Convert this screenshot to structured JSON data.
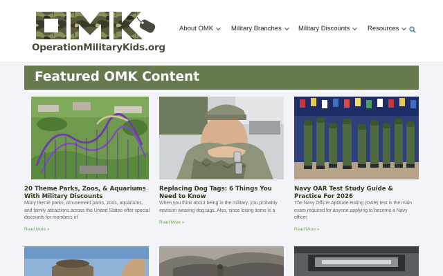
{
  "header": {
    "logo_text": "OperationMilitaryKids.org",
    "nav": [
      {
        "label": "About OMK",
        "icon": "chevron-down-icon"
      },
      {
        "label": "Military Branches",
        "icon": "chevron-down-icon"
      },
      {
        "label": "Military Discounts",
        "icon": "chevron-down-icon"
      },
      {
        "label": "Resources",
        "icon": "chevron-down-icon"
      }
    ],
    "search_icon": "search-icon"
  },
  "featured": {
    "title": "Featured OMK Content",
    "accent_color": "#667a4d"
  },
  "cards": [
    {
      "title": "20 Theme Parks, Zoos, & Aquariums With Military Discounts",
      "excerpt": "Many theme parks, amusement parks, zoos, aquariums, and family attractions across the United States offer special discounts for members of",
      "more": "Read More »"
    },
    {
      "title": "Replacing Dog Tags: 6 Things You Need to Know",
      "excerpt": "When you think about being in the military, you probably envision wearing dog tags. Also, since losing items is a",
      "more": "Read More »"
    },
    {
      "title": "Navy OAR Test Study Guide & Practice For 2026",
      "excerpt": "The Navy Officer Aptitude Rating (OAR) test is the main exam required for anyone applying to become a Navy officer",
      "more": "Read More »"
    }
  ]
}
